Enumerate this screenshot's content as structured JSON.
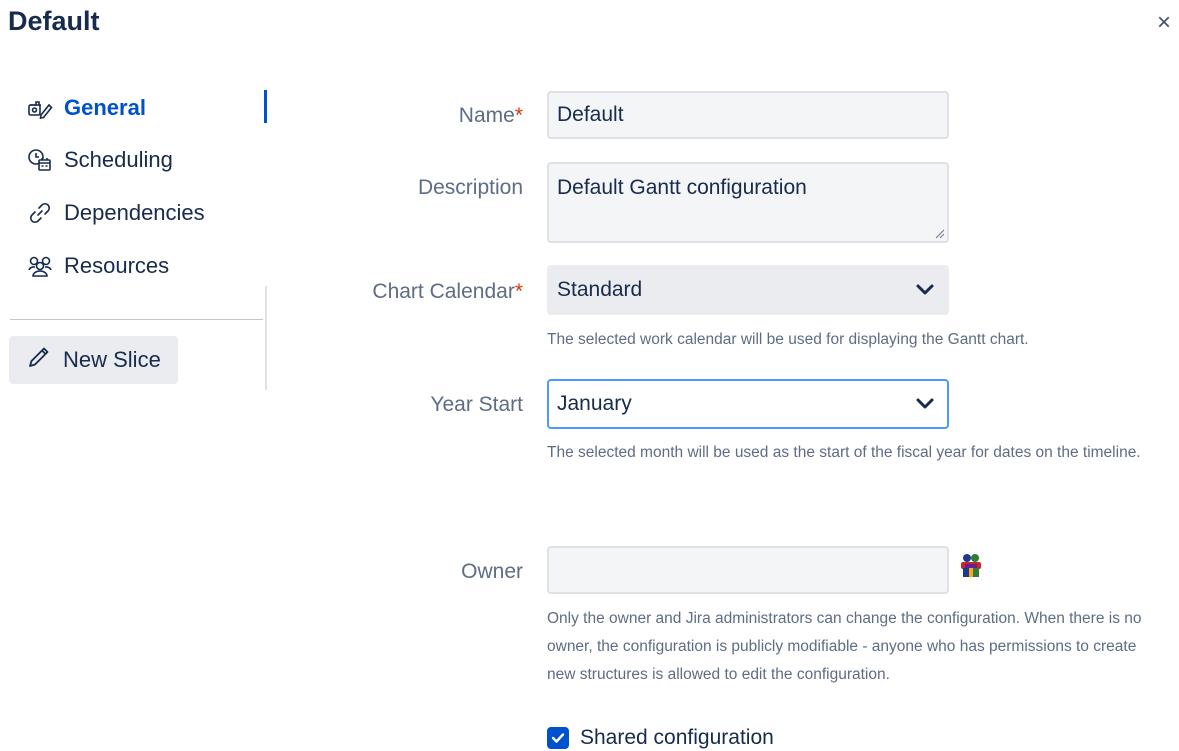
{
  "dialog": {
    "title": "Default",
    "close_glyph": "×"
  },
  "sidebar": {
    "items": [
      {
        "label": "General",
        "icon": "gear-pencil-icon",
        "active": true
      },
      {
        "label": "Scheduling",
        "icon": "clock-calendar-icon",
        "active": false
      },
      {
        "label": "Dependencies",
        "icon": "link-icon",
        "active": false
      },
      {
        "label": "Resources",
        "icon": "people-icon",
        "active": false
      }
    ],
    "new_slice_label": "New Slice"
  },
  "form": {
    "name": {
      "label": "Name",
      "required": "*",
      "value": "Default"
    },
    "description": {
      "label": "Description",
      "value": "Default Gantt configuration"
    },
    "chart_calendar": {
      "label": "Chart Calendar",
      "required": "*",
      "value": "Standard",
      "help": "The selected work calendar will be used for displaying the Gantt chart."
    },
    "year_start": {
      "label": "Year Start",
      "value": "January",
      "help": "The selected month will be used as the start of the fiscal year for dates on the timeline."
    },
    "owner": {
      "label": "Owner",
      "value": "",
      "icon": "user-picker-icon",
      "help": "Only the owner and Jira administrators can change the configuration. When there is no owner, the configuration is publicly modifiable - anyone who has permissions to create new structures is allowed to edit the configuration."
    },
    "shared": {
      "label": "Shared configuration",
      "checked": true
    }
  },
  "colors": {
    "accent": "#0052cc",
    "required": "#de350b",
    "focus": "#4c9aff"
  }
}
